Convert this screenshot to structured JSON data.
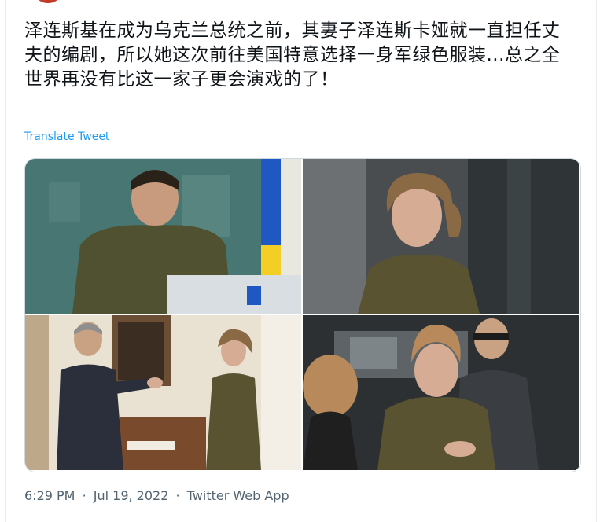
{
  "tweet": {
    "text": "泽连斯基在成为乌克兰总统之前，其妻子泽连斯卡娅就一直担任丈夫的编剧，所以她这次前往美国特意选择一身军绿色服装...总之全世界再没有比这一家子更会演戏的了！",
    "translate_label": "Translate Tweet",
    "time": "6:29 PM",
    "date": "Jul 19, 2022",
    "separator": "·",
    "source": "Twitter Web App"
  },
  "media": {
    "photos": [
      {
        "id": "photo-1",
        "subject": "man in olive sweater at podium"
      },
      {
        "id": "photo-2",
        "subject": "woman in olive outfit portrait"
      },
      {
        "id": "photo-3",
        "subject": "official greeting woman in office"
      },
      {
        "id": "photo-4",
        "subject": "woman walking with security"
      }
    ]
  },
  "colors": {
    "text": "#0f1419",
    "link": "#1d9bf0",
    "meta": "#536471",
    "border": "#cfd9de"
  }
}
